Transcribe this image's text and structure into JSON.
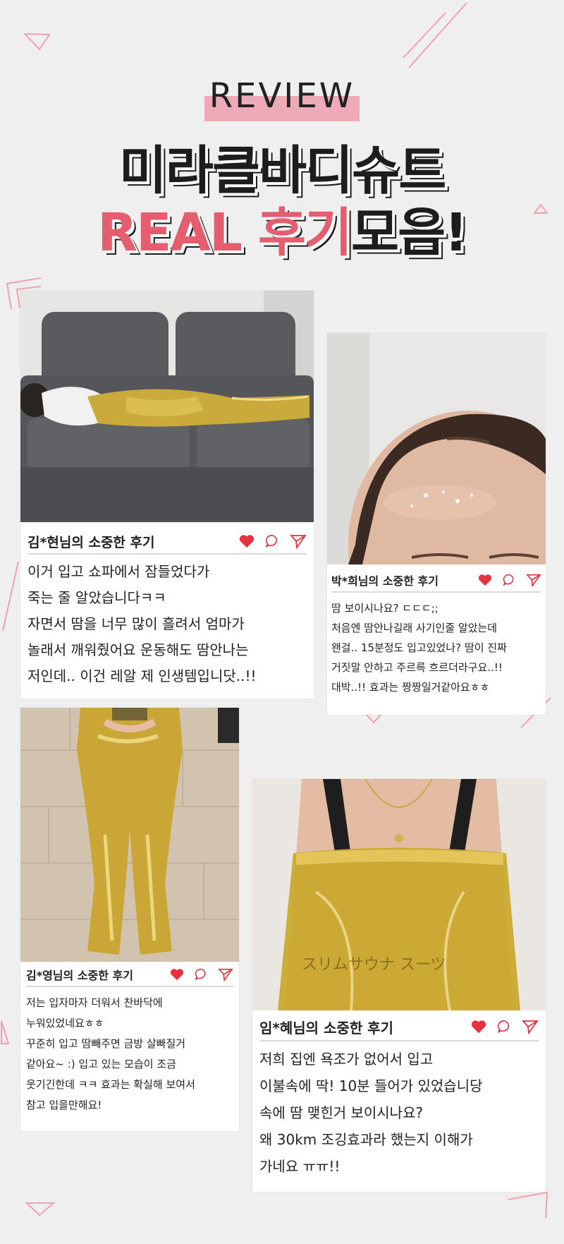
{
  "header": {
    "review": "REVIEW",
    "title_line1": "미라클바디슈트",
    "title_line2_real": "REAL",
    "title_line2_pink": "후기",
    "title_line2_dark": "모음!"
  },
  "colors": {
    "accent_pink": "#e45e70",
    "highlight_pink": "#eeaab7",
    "heart_red": "#e8313f",
    "background": "#efeff0"
  },
  "icons": [
    "heart-icon",
    "comment-icon",
    "share-icon"
  ],
  "reviews": [
    {
      "title": "김*현님의 소중한 후기",
      "lines": [
        "이거 입고 쇼파에서 잠들었다가",
        "죽는 줄 알았습니다ㅋㅋ",
        "자면서 땀을 너무 많이 흘려서 엄마가",
        "놀래서 깨워줬어요 운동해도 땀안나는",
        "저인데.. 이건 레알 제 인생템입니닷..!!"
      ]
    },
    {
      "title": "박*희님의 소중한 후기",
      "lines": [
        "땀 보이시나요? ㄷㄷㄷ;;",
        "처음엔 땀안나길래 사기인줄 알았는데",
        "왠걸.. 15분정도 입고있었나? 땀이 진짜",
        "거짓말 안하고 주르륵 흐르더라구요..!!",
        "대박..!! 효과는 짱짱일거같아요ㅎㅎ"
      ]
    },
    {
      "title": "김*영님의 소중한 후기",
      "lines": [
        "저는 입자마자 더워서 찬바닥에",
        "누워있었네요ㅎㅎ",
        "꾸준히 입고 땀빼주면 금방 살빠질거",
        "같아요~ :) 입고 있는 모습이 조금",
        "웃기긴한데 ㅋㅋ 효과는 확실해 보여서",
        "참고 입을만해요!"
      ]
    },
    {
      "title": "임*혜님의 소중한 후기",
      "lines": [
        "저희 집엔 욕조가 없어서 입고",
        "이불속에 딱! 10분 들어가 있었습니당",
        "속에 땀 맺힌거 보이시나요?",
        "왜 30km 조깅효과라 했는지 이해가",
        "가네요 ㅠㅠ!!"
      ]
    }
  ]
}
